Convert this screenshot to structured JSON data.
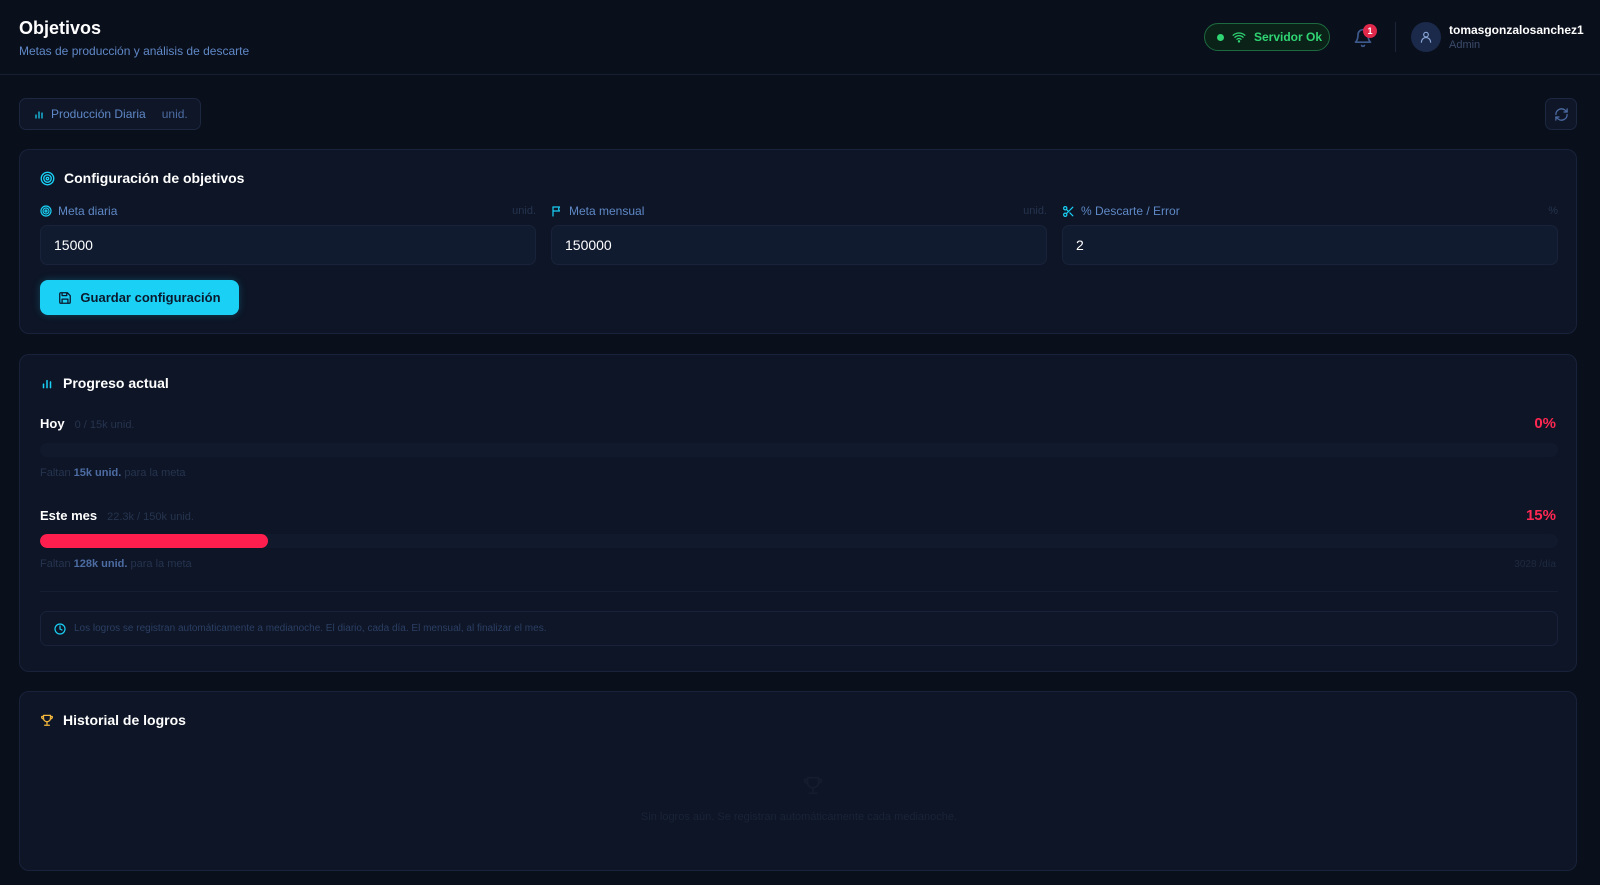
{
  "header": {
    "title": "Objetivos",
    "subtitle": "Metas de producción y análisis de descarte",
    "server_status": "Servidor Ok",
    "notifications_count": "1",
    "user": {
      "name": "tomasgonzalosanchez1",
      "role": "Admin"
    }
  },
  "toolbar": {
    "chip_label": "Producción Diaria",
    "chip_unit": "unid."
  },
  "config": {
    "title": "Configuración de objetivos",
    "fields": [
      {
        "label": "Meta diaria",
        "unit": "unid.",
        "value": "15000"
      },
      {
        "label": "Meta mensual",
        "unit": "unid.",
        "value": "150000"
      },
      {
        "label": "% Descarte / Error",
        "unit": "%",
        "value": "2"
      }
    ],
    "save_label": "Guardar configuración"
  },
  "progress": {
    "title": "Progreso actual",
    "today": {
      "label": "Hoy",
      "count": "0 / 15k unid.",
      "percent_text": "0%",
      "percent": 0,
      "remaining_prefix": "Faltan",
      "remaining_value": "15k unid.",
      "remaining_suffix": "para la meta"
    },
    "month": {
      "label": "Este mes",
      "count": "22.3k / 150k unid.",
      "percent_text": "15%",
      "percent": 15,
      "remaining_prefix": "Faltan",
      "remaining_value": "128k unid.",
      "remaining_suffix": "para la meta",
      "extra": "3028 /día"
    },
    "info": "Los logros se registran automáticamente a medianoche. El diario, cada día. El mensual, al finalizar el mes."
  },
  "history": {
    "title": "Historial de logros",
    "empty_text": "Sin logros aún. Se registran automáticamente cada medianoche."
  },
  "colors": {
    "accent": "#1ad0f5",
    "danger": "#ff1e4e",
    "success": "#2fd573",
    "trophy": "#f5b83d"
  }
}
